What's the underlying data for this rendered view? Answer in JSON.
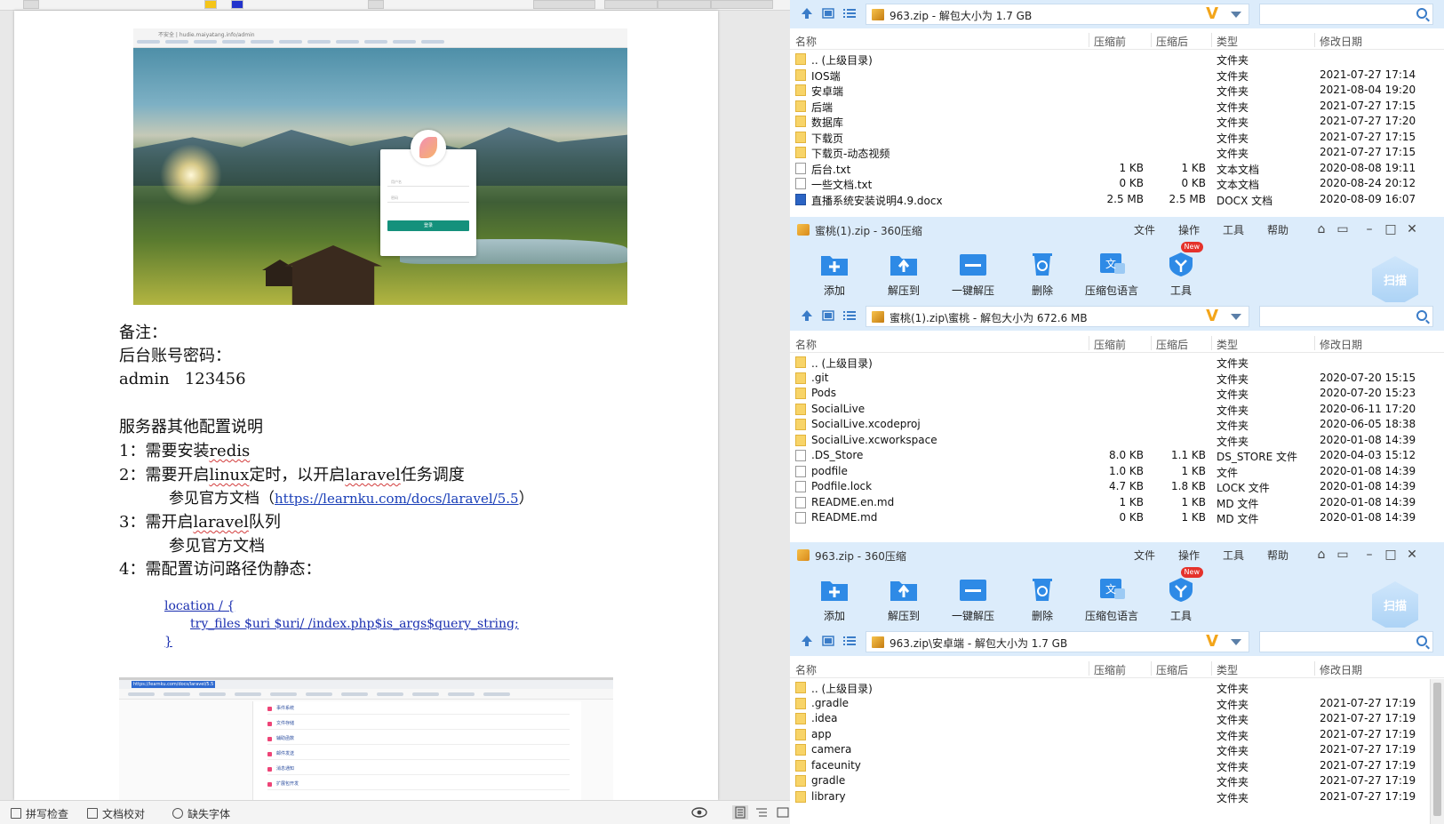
{
  "document": {
    "notes_heading": "备注：",
    "account_label": "后台账号密码：",
    "account_value": "admin   123456",
    "server_heading": "服务器其他配置说明",
    "item1_prefix": "1：需要安装",
    "item1_word": "redis",
    "item2_prefix": "2：需要开启",
    "item2_word1": "linux",
    "item2_mid": "定时，以开启",
    "item2_word2": "laravel",
    "item2_suffix": "任务调度",
    "item2_see": "参见官方文档（",
    "item2_link": "https://learnku.com/docs/laravel/5.5",
    "item2_close": "）",
    "item3_prefix": "3：需开启",
    "item3_word": "laravel",
    "item3_suffix": "队列",
    "item3_see": "参见官方文档",
    "item4": "4：需配置访问路径伪静态：",
    "code_line1": "location / {",
    "code_line2": "try_files $uri $uri/ /index.php$is_args$query_string;",
    "code_line3": "}",
    "shot1_url": "不安全 | hudie.maiyatang.info/admin",
    "shot1_username_ph": "用户名",
    "shot1_password_ph": "密码",
    "shot1_login_btn": "登录",
    "shot2_url": "https://learnku.com/docs/laravel/5.5",
    "shot2_items": [
      "事件系统",
      "文件存储",
      "辅助函数",
      "邮件发送",
      "消息通知",
      "扩展包开发"
    ]
  },
  "statusbar": {
    "spellcheck": "拼写检查",
    "doc_proof": "文档校对",
    "missing_fonts": "缺失字体"
  },
  "columns": {
    "name": "名称",
    "before": "压缩前",
    "after": "压缩后",
    "type": "类型",
    "modified": "修改日期"
  },
  "toolbar": {
    "add": "添加",
    "extract_to": "解压到",
    "one_click_extract": "一键解压",
    "delete": "删除",
    "archive_language": "压缩包语言",
    "tools": "工具",
    "new_badge": "New",
    "scan": "扫描"
  },
  "menus": [
    "文件",
    "操作",
    "工具",
    "帮助"
  ],
  "window1": {
    "path": "963.zip - 解包大小为 1.7 GB",
    "rows": [
      {
        "icon": "folder",
        "name": ".. (上级目录)",
        "before": "",
        "after": "",
        "type": "文件夹",
        "modified": ""
      },
      {
        "icon": "folder",
        "name": "IOS端",
        "before": "",
        "after": "",
        "type": "文件夹",
        "modified": "2021-07-27 17:14"
      },
      {
        "icon": "folder",
        "name": "安卓端",
        "before": "",
        "after": "",
        "type": "文件夹",
        "modified": "2021-08-04 19:20"
      },
      {
        "icon": "folder",
        "name": "后端",
        "before": "",
        "after": "",
        "type": "文件夹",
        "modified": "2021-07-27 17:15"
      },
      {
        "icon": "folder",
        "name": "数据库",
        "before": "",
        "after": "",
        "type": "文件夹",
        "modified": "2021-07-27 17:20"
      },
      {
        "icon": "folder",
        "name": "下载页",
        "before": "",
        "after": "",
        "type": "文件夹",
        "modified": "2021-07-27 17:15"
      },
      {
        "icon": "folder",
        "name": "下载页-动态视频",
        "before": "",
        "after": "",
        "type": "文件夹",
        "modified": "2021-07-27 17:15"
      },
      {
        "icon": "file",
        "name": "后台.txt",
        "before": "1 KB",
        "after": "1 KB",
        "type": "文本文档",
        "modified": "2020-08-08 19:11"
      },
      {
        "icon": "file",
        "name": "一些文档.txt",
        "before": "0 KB",
        "after": "0 KB",
        "type": "文本文档",
        "modified": "2020-08-24 20:12"
      },
      {
        "icon": "docx",
        "name": "直播系统安装说明4.9.docx",
        "before": "2.5 MB",
        "after": "2.5 MB",
        "type": "DOCX 文档",
        "modified": "2020-08-09 16:07"
      }
    ]
  },
  "window2": {
    "title": "蜜桃(1).zip - 360压缩",
    "path": "蜜桃(1).zip\\蜜桃 - 解包大小为 672.6 MB",
    "rows": [
      {
        "icon": "folder",
        "name": ".. (上级目录)",
        "before": "",
        "after": "",
        "type": "文件夹",
        "modified": ""
      },
      {
        "icon": "folder",
        "name": ".git",
        "before": "",
        "after": "",
        "type": "文件夹",
        "modified": "2020-07-20 15:15"
      },
      {
        "icon": "folder",
        "name": "Pods",
        "before": "",
        "after": "",
        "type": "文件夹",
        "modified": "2020-07-20 15:23"
      },
      {
        "icon": "folder",
        "name": "SocialLive",
        "before": "",
        "after": "",
        "type": "文件夹",
        "modified": "2020-06-11 17:20"
      },
      {
        "icon": "folder",
        "name": "SocialLive.xcodeproj",
        "before": "",
        "after": "",
        "type": "文件夹",
        "modified": "2020-06-05 18:38"
      },
      {
        "icon": "folder",
        "name": "SocialLive.xcworkspace",
        "before": "",
        "after": "",
        "type": "文件夹",
        "modified": "2020-01-08 14:39"
      },
      {
        "icon": "file",
        "name": ".DS_Store",
        "before": "8.0 KB",
        "after": "1.1 KB",
        "type": "DS_STORE 文件",
        "modified": "2020-04-03 15:12"
      },
      {
        "icon": "file",
        "name": "podfile",
        "before": "1.0 KB",
        "after": "1 KB",
        "type": "文件",
        "modified": "2020-01-08 14:39"
      },
      {
        "icon": "file",
        "name": "Podfile.lock",
        "before": "4.7 KB",
        "after": "1.8 KB",
        "type": "LOCK 文件",
        "modified": "2020-01-08 14:39"
      },
      {
        "icon": "file",
        "name": "README.en.md",
        "before": "1 KB",
        "after": "1 KB",
        "type": "MD 文件",
        "modified": "2020-01-08 14:39"
      },
      {
        "icon": "file",
        "name": "README.md",
        "before": "0 KB",
        "after": "1 KB",
        "type": "MD 文件",
        "modified": "2020-01-08 14:39"
      }
    ]
  },
  "window3": {
    "title": "963.zip - 360压缩",
    "path": "963.zip\\安卓端 - 解包大小为 1.7 GB",
    "rows": [
      {
        "icon": "folder",
        "name": ".. (上级目录)",
        "before": "",
        "after": "",
        "type": "文件夹",
        "modified": ""
      },
      {
        "icon": "folder",
        "name": ".gradle",
        "before": "",
        "after": "",
        "type": "文件夹",
        "modified": "2021-07-27 17:19"
      },
      {
        "icon": "folder",
        "name": ".idea",
        "before": "",
        "after": "",
        "type": "文件夹",
        "modified": "2021-07-27 17:19"
      },
      {
        "icon": "folder",
        "name": "app",
        "before": "",
        "after": "",
        "type": "文件夹",
        "modified": "2021-07-27 17:19"
      },
      {
        "icon": "folder",
        "name": "camera",
        "before": "",
        "after": "",
        "type": "文件夹",
        "modified": "2021-07-27 17:19"
      },
      {
        "icon": "folder",
        "name": "faceunity",
        "before": "",
        "after": "",
        "type": "文件夹",
        "modified": "2021-07-27 17:19"
      },
      {
        "icon": "folder",
        "name": "gradle",
        "before": "",
        "after": "",
        "type": "文件夹",
        "modified": "2021-07-27 17:19"
      },
      {
        "icon": "folder",
        "name": "library",
        "before": "",
        "after": "",
        "type": "文件夹",
        "modified": "2021-07-27 17:19"
      }
    ]
  }
}
